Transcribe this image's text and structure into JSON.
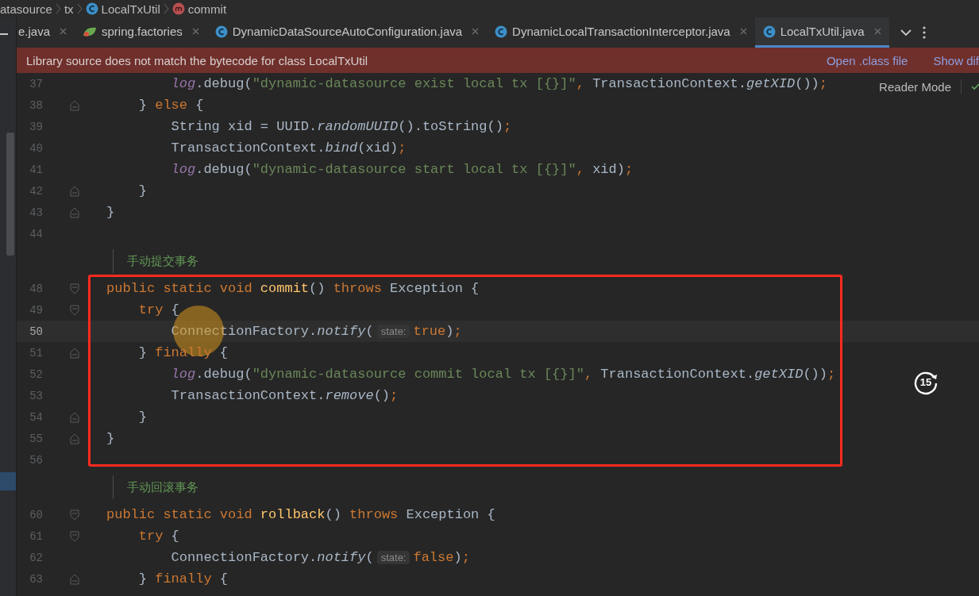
{
  "breadcrumbs": [
    {
      "text": "atasource"
    },
    {
      "text": "tx"
    },
    {
      "text": "LocalTxUtil",
      "kind": "class"
    },
    {
      "text": "commit",
      "kind": "method"
    }
  ],
  "tabs": [
    {
      "label": "e.java",
      "selected": false
    },
    {
      "label": "spring.factories",
      "kind": "spring",
      "selected": false
    },
    {
      "label": "DynamicDataSourceAutoConfiguration.java",
      "kind": "class",
      "selected": false
    },
    {
      "label": "DynamicLocalTransactionInterceptor.java",
      "kind": "class",
      "selected": false
    },
    {
      "label": "LocalTxUtil.java",
      "kind": "class",
      "selected": true
    }
  ],
  "banner": {
    "message": "Library source does not match the bytecode for class LocalTxUtil",
    "actions": [
      "Open .class file",
      "Show dif"
    ]
  },
  "reader_mode": "Reader Mode",
  "lines": [
    {
      "kind": "code",
      "number": "37",
      "fold_start": false,
      "fold_end": false,
      "tokens": [
        {
          "kind": "field",
          "text": "log"
        },
        {
          "kind": "plain",
          "text": ".debug("
        },
        {
          "kind": "str",
          "text": "\"dynamic-datasource exist local tx [{}]\""
        },
        {
          "kind": "punct",
          "text": ", "
        },
        {
          "kind": "plain",
          "text": "TransactionContext."
        },
        {
          "kind": "call",
          "text": "getXID"
        },
        {
          "kind": "plain",
          "text": "())"
        },
        {
          "kind": "punct",
          "text": ";"
        }
      ]
    },
    {
      "kind": "code",
      "number": "38",
      "fold_start": false,
      "fold_end": true,
      "tokens": [
        {
          "kind": "plain",
          "text": "} "
        },
        {
          "kind": "kw",
          "text": "else"
        },
        {
          "kind": "plain",
          "text": " {"
        }
      ]
    },
    {
      "kind": "code",
      "number": "39",
      "fold_start": false,
      "fold_end": false,
      "tokens": [
        {
          "kind": "plain",
          "text": "String xid = UUID."
        },
        {
          "kind": "call",
          "text": "randomUUID"
        },
        {
          "kind": "plain",
          "text": "().toString()"
        },
        {
          "kind": "punct",
          "text": ";"
        }
      ]
    },
    {
      "kind": "code",
      "number": "40",
      "fold_start": false,
      "fold_end": false,
      "tokens": [
        {
          "kind": "plain",
          "text": "TransactionContext."
        },
        {
          "kind": "call",
          "text": "bind"
        },
        {
          "kind": "plain",
          "text": "(xid)"
        },
        {
          "kind": "punct",
          "text": ";"
        }
      ]
    },
    {
      "kind": "code",
      "number": "41",
      "fold_start": false,
      "fold_end": false,
      "tokens": [
        {
          "kind": "field",
          "text": "log"
        },
        {
          "kind": "plain",
          "text": ".debug("
        },
        {
          "kind": "str",
          "text": "\"dynamic-datasource start local tx [{}]\""
        },
        {
          "kind": "punct",
          "text": ", "
        },
        {
          "kind": "plain",
          "text": "xid)"
        },
        {
          "kind": "punct",
          "text": ";"
        }
      ]
    },
    {
      "kind": "code",
      "number": "42",
      "fold_start": false,
      "fold_end": true,
      "tokens": [
        {
          "kind": "plain",
          "text": "}"
        }
      ]
    },
    {
      "kind": "code",
      "number": "43",
      "fold_start": false,
      "fold_end": true,
      "tokens": [
        {
          "kind": "plain",
          "text": "}"
        }
      ]
    },
    {
      "kind": "code",
      "number": "44",
      "fold_start": false,
      "fold_end": false
    },
    {
      "kind": "doc",
      "text": "手动提交事务"
    },
    {
      "kind": "code",
      "number": "48",
      "fold_start": true,
      "fold_end": false,
      "tokens": [
        {
          "kind": "kw",
          "text": "public static void "
        },
        {
          "kind": "decl",
          "text": "commit"
        },
        {
          "kind": "plain",
          "text": "() "
        },
        {
          "kind": "kw",
          "text": "throws "
        },
        {
          "kind": "plain",
          "text": "Exception {"
        }
      ]
    },
    {
      "kind": "code",
      "number": "49",
      "fold_start": true,
      "fold_end": false,
      "tokens": [
        {
          "kind": "kw",
          "text": "try "
        },
        {
          "kind": "plain",
          "text": "{"
        }
      ]
    },
    {
      "kind": "code",
      "number": "50",
      "current": true,
      "fold_start": false,
      "fold_end": false,
      "tokens": [
        {
          "kind": "plain",
          "text": "ConnectionFactory."
        },
        {
          "kind": "call",
          "text": "notify"
        },
        {
          "kind": "plain",
          "text": "("
        },
        {
          "kind": "hint",
          "text": "state:"
        },
        {
          "kind": "kw",
          "text": "true"
        },
        {
          "kind": "plain",
          "text": ")"
        },
        {
          "kind": "punct",
          "text": ";"
        }
      ]
    },
    {
      "kind": "code",
      "number": "51",
      "fold_start": false,
      "fold_end": true,
      "tokens": [
        {
          "kind": "plain",
          "text": "} "
        },
        {
          "kind": "kw",
          "text": "finally"
        },
        {
          "kind": "plain",
          "text": " {"
        }
      ]
    },
    {
      "kind": "code",
      "number": "52",
      "fold_start": false,
      "fold_end": false,
      "tokens": [
        {
          "kind": "field",
          "text": "log"
        },
        {
          "kind": "plain",
          "text": ".debug("
        },
        {
          "kind": "str",
          "text": "\"dynamic-datasource commit local tx [{}]\""
        },
        {
          "kind": "punct",
          "text": ", "
        },
        {
          "kind": "plain",
          "text": "TransactionContext."
        },
        {
          "kind": "call",
          "text": "getXID"
        },
        {
          "kind": "plain",
          "text": "())"
        },
        {
          "kind": "punct",
          "text": ";"
        }
      ]
    },
    {
      "kind": "code",
      "number": "53",
      "fold_start": false,
      "fold_end": false,
      "tokens": [
        {
          "kind": "plain",
          "text": "TransactionContext."
        },
        {
          "kind": "call",
          "text": "remove"
        },
        {
          "kind": "plain",
          "text": "()"
        },
        {
          "kind": "punct",
          "text": ";"
        }
      ]
    },
    {
      "kind": "code",
      "number": "54",
      "fold_start": false,
      "fold_end": true,
      "tokens": [
        {
          "kind": "plain",
          "text": "}"
        }
      ]
    },
    {
      "kind": "code",
      "number": "55",
      "fold_start": false,
      "fold_end": true,
      "tokens": [
        {
          "kind": "plain",
          "text": "}"
        }
      ]
    },
    {
      "kind": "code",
      "number": "56",
      "fold_start": false,
      "fold_end": false
    },
    {
      "kind": "doc",
      "text": "手动回滚事务"
    },
    {
      "kind": "code",
      "number": "60",
      "fold_start": true,
      "fold_end": false,
      "tokens": [
        {
          "kind": "kw",
          "text": "public static void "
        },
        {
          "kind": "decl",
          "text": "rollback"
        },
        {
          "kind": "plain",
          "text": "() "
        },
        {
          "kind": "kw",
          "text": "throws "
        },
        {
          "kind": "plain",
          "text": "Exception {"
        }
      ]
    },
    {
      "kind": "code",
      "number": "61",
      "fold_start": true,
      "fold_end": false,
      "tokens": [
        {
          "kind": "kw",
          "text": "try "
        },
        {
          "kind": "plain",
          "text": "{"
        }
      ]
    },
    {
      "kind": "code",
      "number": "62",
      "fold_start": false,
      "fold_end": false,
      "tokens": [
        {
          "kind": "plain",
          "text": "ConnectionFactory."
        },
        {
          "kind": "call",
          "text": "notify"
        },
        {
          "kind": "plain",
          "text": "("
        },
        {
          "kind": "hint",
          "text": "state:"
        },
        {
          "kind": "kw",
          "text": "false"
        },
        {
          "kind": "plain",
          "text": ")"
        },
        {
          "kind": "punct",
          "text": ";"
        }
      ]
    },
    {
      "kind": "code",
      "number": "63",
      "fold_start": false,
      "fold_end": true,
      "tokens": [
        {
          "kind": "plain",
          "text": "} "
        },
        {
          "kind": "kw",
          "text": "finally"
        },
        {
          "kind": "plain",
          "text": " {"
        }
      ]
    }
  ],
  "skip_button": "15"
}
